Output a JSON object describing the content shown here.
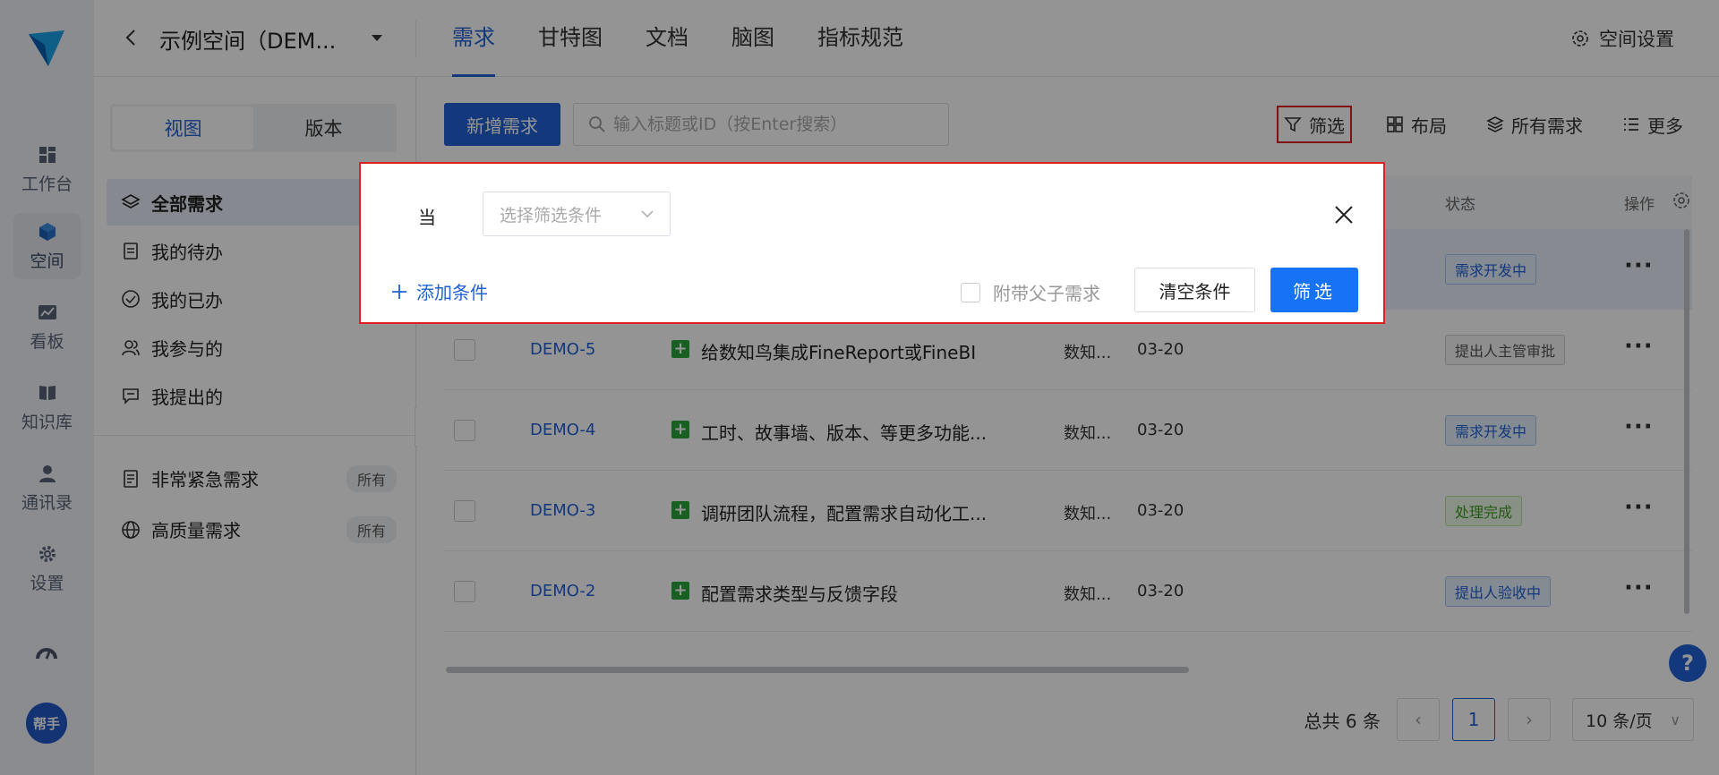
{
  "colors": {
    "accent": "#2161d6",
    "highlight": "#e02020",
    "type_green": "#2aa53a"
  },
  "rail": {
    "items": [
      {
        "label": "工作台",
        "icon": "dashboard-icon"
      },
      {
        "label": "空间",
        "icon": "cube-icon"
      },
      {
        "label": "看板",
        "icon": "chart-icon"
      },
      {
        "label": "知识库",
        "icon": "book-icon"
      },
      {
        "label": "通讯录",
        "icon": "contacts-icon"
      },
      {
        "label": "设置",
        "icon": "gear-icon"
      }
    ],
    "helper_label": "帮手"
  },
  "header": {
    "space_name": "示例空间（DEM...",
    "tabs": [
      "需求",
      "甘特图",
      "文档",
      "脑图",
      "指标规范"
    ],
    "space_settings": "空间设置"
  },
  "sidebar": {
    "segments": [
      "视图",
      "版本"
    ],
    "nav": [
      "全部需求",
      "我的待办",
      "我的已办",
      "我参与的",
      "我提出的"
    ],
    "saved": [
      {
        "label": "非常紧急需求",
        "badge": "所有"
      },
      {
        "label": "高质量需求",
        "badge": "所有"
      }
    ]
  },
  "toolbar": {
    "new_label": "新增需求",
    "search_placeholder": "输入标题或ID（按Enter搜索）",
    "filter": "筛选",
    "layout": "布局",
    "all": "所有需求",
    "more": "更多"
  },
  "table": {
    "head": {
      "status": "状态",
      "op": "操作"
    },
    "rows": [
      {
        "id": "",
        "title": "",
        "proj": "",
        "date": "",
        "status": "需求开发中",
        "kind": "blue"
      },
      {
        "id": "DEMO-5",
        "title": "给数知鸟集成FineReport或FineBI",
        "proj": "数知...",
        "date": "03-20",
        "status": "提出人主管审批",
        "kind": "gray"
      },
      {
        "id": "DEMO-4",
        "title": "工时、故事墙、版本、等更多功能...",
        "proj": "数知...",
        "date": "03-20",
        "status": "需求开发中",
        "kind": "blue"
      },
      {
        "id": "DEMO-3",
        "title": "调研团队流程，配置需求自动化工...",
        "proj": "数知...",
        "date": "03-20",
        "status": "处理完成",
        "kind": "green"
      },
      {
        "id": "DEMO-2",
        "title": "配置需求类型与反馈字段",
        "proj": "数知...",
        "date": "03-20",
        "status": "提出人验收中",
        "kind": "blue"
      }
    ]
  },
  "pager": {
    "total": "总共 6 条",
    "current": "1",
    "size": "10 条/页"
  },
  "help_fab": "?",
  "filter_popup": {
    "when": "当",
    "select_placeholder": "选择筛选条件",
    "add": "添加条件",
    "attach": "附带父子需求",
    "clear": "清空条件",
    "apply": "筛选"
  }
}
